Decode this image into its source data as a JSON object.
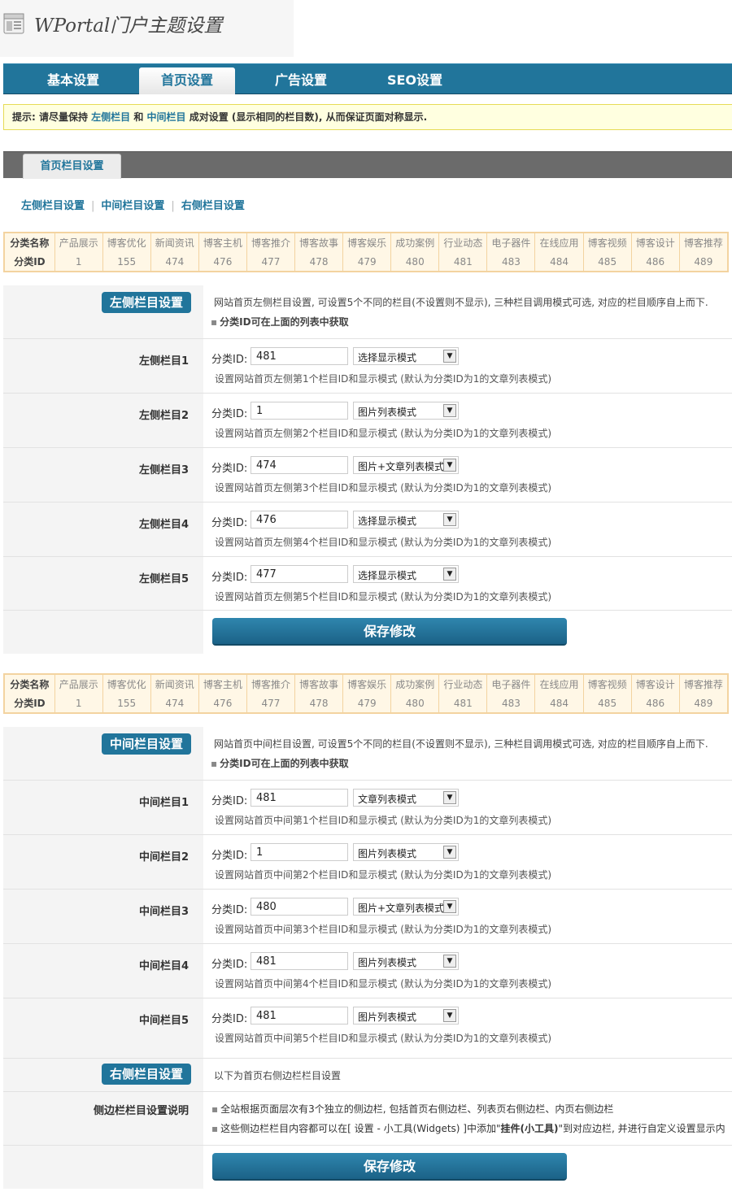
{
  "header": {
    "title": "WPortal门户主题设置",
    "icon": "page-settings-icon"
  },
  "nav": {
    "tabs": [
      "基本设置",
      "首页设置",
      "广告设置",
      "SEO设置"
    ],
    "active": 1
  },
  "notice": {
    "prefix": "提示: 请尽量保持 ",
    "hl1": "左侧栏目",
    "mid": " 和 ",
    "hl2": "中间栏目",
    "suffix": " 成对设置 (显示相同的栏目数), 从而保证页面对称显示."
  },
  "section_tab": "首页栏目设置",
  "sublinks": [
    "左侧栏目设置",
    "中间栏目设置",
    "右侧栏目设置"
  ],
  "category_table": {
    "name_header": "分类名称",
    "id_header": "分类ID",
    "names": [
      "产品展示",
      "博客优化",
      "新闻资讯",
      "博客主机",
      "博客推介",
      "博客故事",
      "博客娱乐",
      "成功案例",
      "行业动态",
      "电子器件",
      "在线应用",
      "博客视频",
      "博客设计",
      "博客推荐"
    ],
    "ids": [
      "1",
      "155",
      "474",
      "476",
      "477",
      "478",
      "479",
      "480",
      "481",
      "483",
      "484",
      "485",
      "486",
      "489"
    ]
  },
  "common": {
    "field_label": "分类ID:",
    "select_arrow": "▼",
    "save_label": "保存修改",
    "id_hint": "分类ID可在上面的列表中获取",
    "bullet": "▪"
  },
  "left_section": {
    "title": "左侧栏目设置",
    "desc": "网站首页左侧栏目设置, 可设置5个不同的栏目(不设置则不显示), 三种栏目调用模式可选, 对应的栏目顺序自上而下.",
    "rows": [
      {
        "label": "左侧栏目1",
        "id": "481",
        "mode": "选择显示模式",
        "help": "设置网站首页左侧第1个栏目ID和显示模式 (默认为分类ID为1的文章列表模式)"
      },
      {
        "label": "左侧栏目2",
        "id": "1",
        "mode": "图片列表模式",
        "help": "设置网站首页左侧第2个栏目ID和显示模式 (默认为分类ID为1的文章列表模式)"
      },
      {
        "label": "左侧栏目3",
        "id": "474",
        "mode": "图片+文章列表模式",
        "help": "设置网站首页左侧第3个栏目ID和显示模式 (默认为分类ID为1的文章列表模式)"
      },
      {
        "label": "左侧栏目4",
        "id": "476",
        "mode": "选择显示模式",
        "help": "设置网站首页左侧第4个栏目ID和显示模式 (默认为分类ID为1的文章列表模式)"
      },
      {
        "label": "左侧栏目5",
        "id": "477",
        "mode": "选择显示模式",
        "help": "设置网站首页左侧第5个栏目ID和显示模式 (默认为分类ID为1的文章列表模式)"
      }
    ]
  },
  "middle_section": {
    "title": "中间栏目设置",
    "desc": "网站首页中间栏目设置, 可设置5个不同的栏目(不设置则不显示), 三种栏目调用模式可选, 对应的栏目顺序自上而下.",
    "rows": [
      {
        "label": "中间栏目1",
        "id": "481",
        "mode": "文章列表模式",
        "help": "设置网站首页中间第1个栏目ID和显示模式 (默认为分类ID为1的文章列表模式)"
      },
      {
        "label": "中间栏目2",
        "id": "1",
        "mode": "图片列表模式",
        "help": "设置网站首页中间第2个栏目ID和显示模式 (默认为分类ID为1的文章列表模式)"
      },
      {
        "label": "中间栏目3",
        "id": "480",
        "mode": "图片+文章列表模式",
        "help": "设置网站首页中间第3个栏目ID和显示模式 (默认为分类ID为1的文章列表模式)"
      },
      {
        "label": "中间栏目4",
        "id": "481",
        "mode": "图片列表模式",
        "help": "设置网站首页中间第4个栏目ID和显示模式 (默认为分类ID为1的文章列表模式)"
      },
      {
        "label": "中间栏目5",
        "id": "481",
        "mode": "图片列表模式",
        "help": "设置网站首页中间第5个栏目ID和显示模式 (默认为分类ID为1的文章列表模式)"
      }
    ]
  },
  "right_section": {
    "title": "右侧栏目设置",
    "desc": "以下为首页右侧边栏栏目设置",
    "sidebar_label": "侧边栏栏目设置说明",
    "line1": "全站根据页面层次有3个独立的侧边栏, 包括首页右侧边栏、列表页右侧边栏、内页右侧边栏",
    "line2_pre": "这些侧边栏栏目内容都可以在[ 设置 - 小工具(Widgets) ]中添加\"",
    "line2_bold": "挂件(小工具)",
    "line2_post": "\"到对应边栏, 并进行自定义设置显示内"
  }
}
